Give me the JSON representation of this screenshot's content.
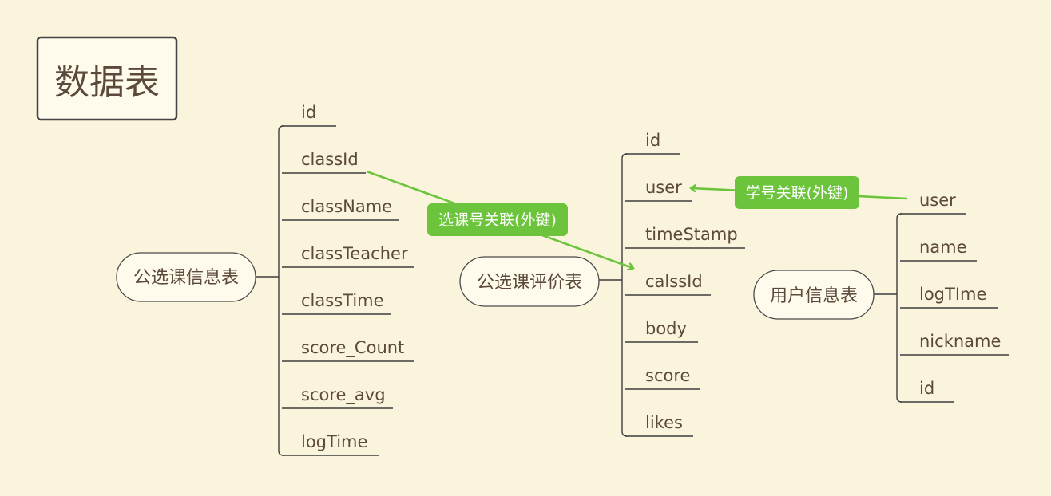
{
  "title": "数据表",
  "tables": {
    "course": {
      "label": "公选课信息表",
      "fields": [
        "id",
        "classId",
        "className",
        "classTeacher",
        "classTime",
        "score_Count",
        "score_avg",
        "logTime"
      ]
    },
    "review": {
      "label": "公选课评价表",
      "fields": [
        "id",
        "user",
        "timeStamp",
        "calssId",
        "body",
        "score",
        "likes"
      ]
    },
    "user": {
      "label": "用户信息表",
      "fields": [
        "user",
        "name",
        "logTIme",
        "nickname",
        "id"
      ]
    }
  },
  "relations": {
    "course_to_review": "选课号关联(外键)",
    "user_to_review": "学号关联(外键)"
  },
  "colors": {
    "background": "#fbf4dd",
    "relation": "#6cc43c",
    "text": "#5b4a3a"
  }
}
